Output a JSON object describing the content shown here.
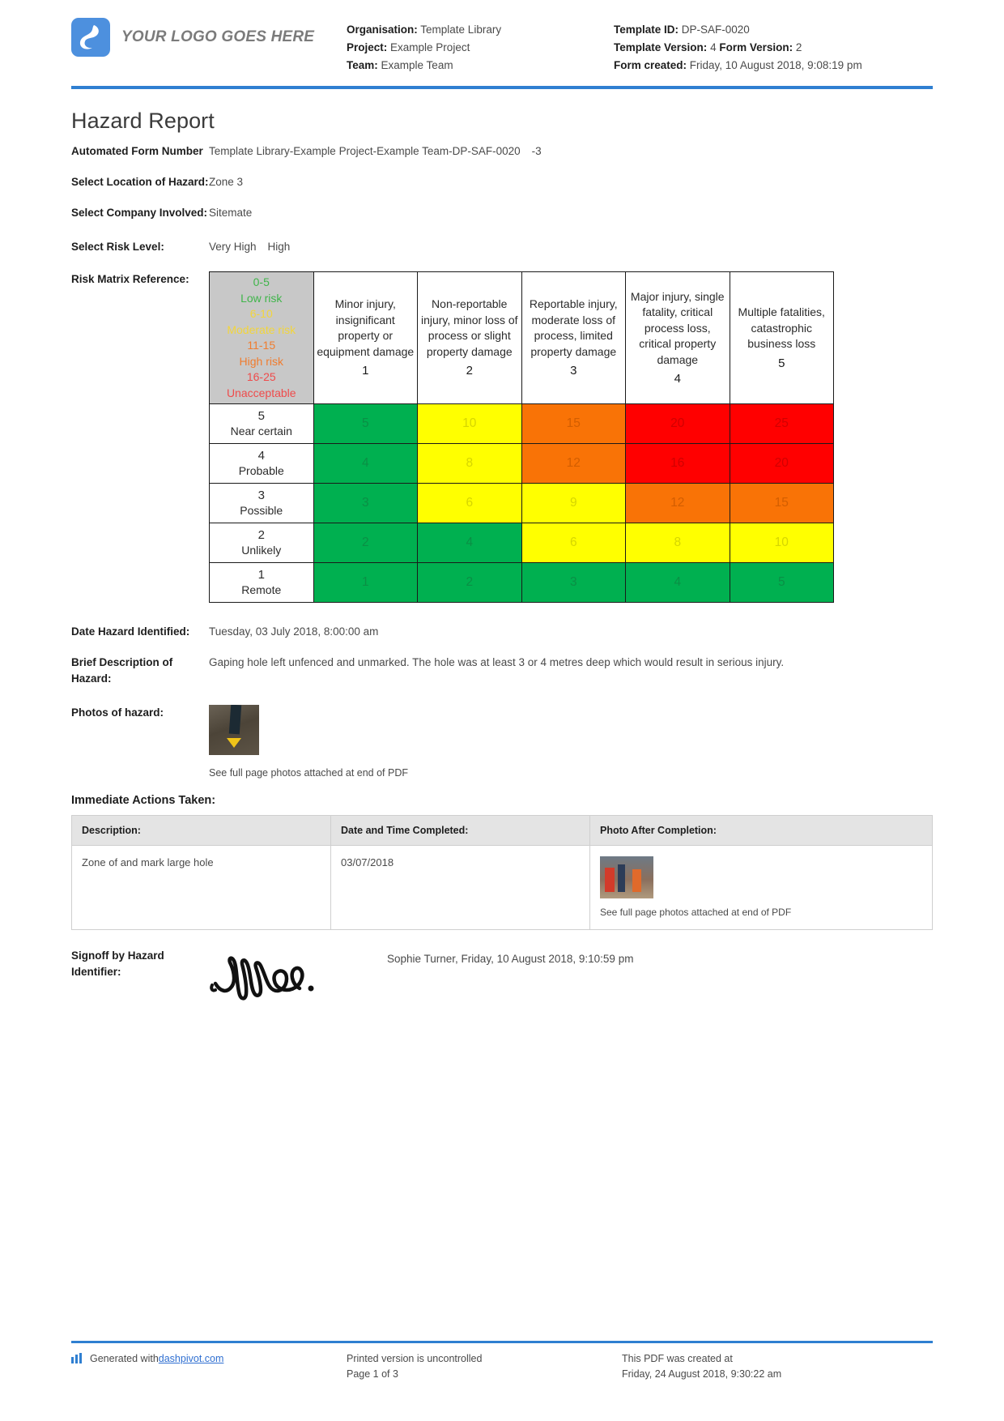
{
  "header": {
    "logo_text": "YOUR LOGO GOES HERE",
    "fields": [
      {
        "label": "Organisation:",
        "value": "Template Library"
      },
      {
        "label": "Project:",
        "value": "Example Project"
      },
      {
        "label": "Team:",
        "value": "Example Team"
      }
    ],
    "fields2": [
      {
        "label": "Template ID:",
        "value": "DP-SAF-0020"
      },
      {
        "label": "Template Version:",
        "value": "4",
        "label_b": "Form Version:",
        "value_b": "2"
      },
      {
        "label": "Form created:",
        "value": "Friday, 10 August 2018, 9:08:19 pm"
      }
    ]
  },
  "title": "Hazard Report",
  "form_fields": {
    "form_number_label": "Automated Form Number",
    "form_number_value": "Template Library-Example Project-Example Team-DP-SAF-0020",
    "form_number_suffix": "-3",
    "location_label": "Select Location of Hazard:",
    "location_value": "Zone 3",
    "company_label": "Select Company Involved:",
    "company_value": "Sitemate",
    "risk_level_label": "Select Risk Level:",
    "risk_level_value_1": "Very High",
    "risk_level_value_2": "High",
    "matrix_label": "Risk Matrix Reference:",
    "date_identified_label": "Date Hazard Identified:",
    "date_identified_value": "Tuesday, 03 July 2018, 8:00:00 am",
    "description_label": "Brief Description of Hazard:",
    "description_value": "Gaping hole left unfenced and unmarked. The hole was at least 3 or 4 metres deep which would result in serious injury.",
    "photos_label": "Photos of hazard:",
    "photos_caption": "See full page photos attached at end of PDF"
  },
  "chart_data": {
    "type": "heatmap",
    "title": "Risk Matrix Reference",
    "legend": [
      {
        "range": "0-5",
        "label": "Low risk",
        "color": "#3fb54a"
      },
      {
        "range": "6-10",
        "label": "Moderate risk",
        "color": "#f2d53c"
      },
      {
        "range": "11-15",
        "label": "High risk",
        "color": "#f07c2e"
      },
      {
        "range": "16-25",
        "label": "Unacceptable",
        "color": "#ef4b4b"
      }
    ],
    "severity_headers": [
      {
        "text": "Minor injury, insignificant property or equipment damage",
        "num": "1"
      },
      {
        "text": "Non-reportable injury, minor loss of process or slight property damage",
        "num": "2"
      },
      {
        "text": "Reportable injury, moderate loss of process, limited property damage",
        "num": "3"
      },
      {
        "text": "Major injury, single fatality, critical process loss, critical property damage",
        "num": "4"
      },
      {
        "text": "Multiple fatalities, catastrophic business loss",
        "num": "5"
      }
    ],
    "likelihood_headers": [
      {
        "num": "5",
        "label": "Near certain"
      },
      {
        "num": "4",
        "label": "Probable"
      },
      {
        "num": "3",
        "label": "Possible"
      },
      {
        "num": "2",
        "label": "Unlikely"
      },
      {
        "num": "1",
        "label": "Remote"
      }
    ],
    "rows": [
      {
        "likelihood": "5",
        "cells": [
          {
            "value": "5",
            "bg": "green"
          },
          {
            "value": "10",
            "bg": "yellow"
          },
          {
            "value": "15",
            "bg": "orange"
          },
          {
            "value": "20",
            "bg": "red"
          },
          {
            "value": "25",
            "bg": "red"
          }
        ]
      },
      {
        "likelihood": "4",
        "cells": [
          {
            "value": "4",
            "bg": "green"
          },
          {
            "value": "8",
            "bg": "yellow"
          },
          {
            "value": "12",
            "bg": "orange"
          },
          {
            "value": "16",
            "bg": "red"
          },
          {
            "value": "20",
            "bg": "red"
          }
        ]
      },
      {
        "likelihood": "3",
        "cells": [
          {
            "value": "3",
            "bg": "green"
          },
          {
            "value": "6",
            "bg": "yellow"
          },
          {
            "value": "9",
            "bg": "yellow"
          },
          {
            "value": "12",
            "bg": "orange"
          },
          {
            "value": "15",
            "bg": "orange"
          }
        ]
      },
      {
        "likelihood": "2",
        "cells": [
          {
            "value": "2",
            "bg": "green"
          },
          {
            "value": "4",
            "bg": "green"
          },
          {
            "value": "6",
            "bg": "yellow"
          },
          {
            "value": "8",
            "bg": "yellow"
          },
          {
            "value": "10",
            "bg": "yellow"
          }
        ]
      },
      {
        "likelihood": "1",
        "cells": [
          {
            "value": "1",
            "bg": "green"
          },
          {
            "value": "2",
            "bg": "green"
          },
          {
            "value": "3",
            "bg": "green"
          },
          {
            "value": "4",
            "bg": "green"
          },
          {
            "value": "5",
            "bg": "green"
          }
        ]
      }
    ],
    "colors": {
      "green": "#00b050",
      "yellow": "#ffff00",
      "orange": "#f97306",
      "red": "#ff0000"
    }
  },
  "actions": {
    "heading": "Immediate Actions Taken:",
    "columns": [
      "Description:",
      "Date and Time Completed:",
      "Photo After Completion:"
    ],
    "rows": [
      {
        "description": "Zone of and mark large hole",
        "date": "03/07/2018",
        "photo_caption": "See full page photos attached at end of PDF"
      }
    ]
  },
  "signoff": {
    "label": "Signoff by Hazard Identifier:",
    "name_date": "Sophie Turner, Friday, 10 August 2018, 9:10:59 pm"
  },
  "footer": {
    "generated_prefix": "Generated with ",
    "generated_link": "dashpivot.com",
    "uncontrolled": "Printed version is uncontrolled",
    "page": "Page 1 of 3",
    "created_at": "This PDF was created at",
    "created_date": "Friday, 24 August 2018, 9:30:22 am"
  }
}
